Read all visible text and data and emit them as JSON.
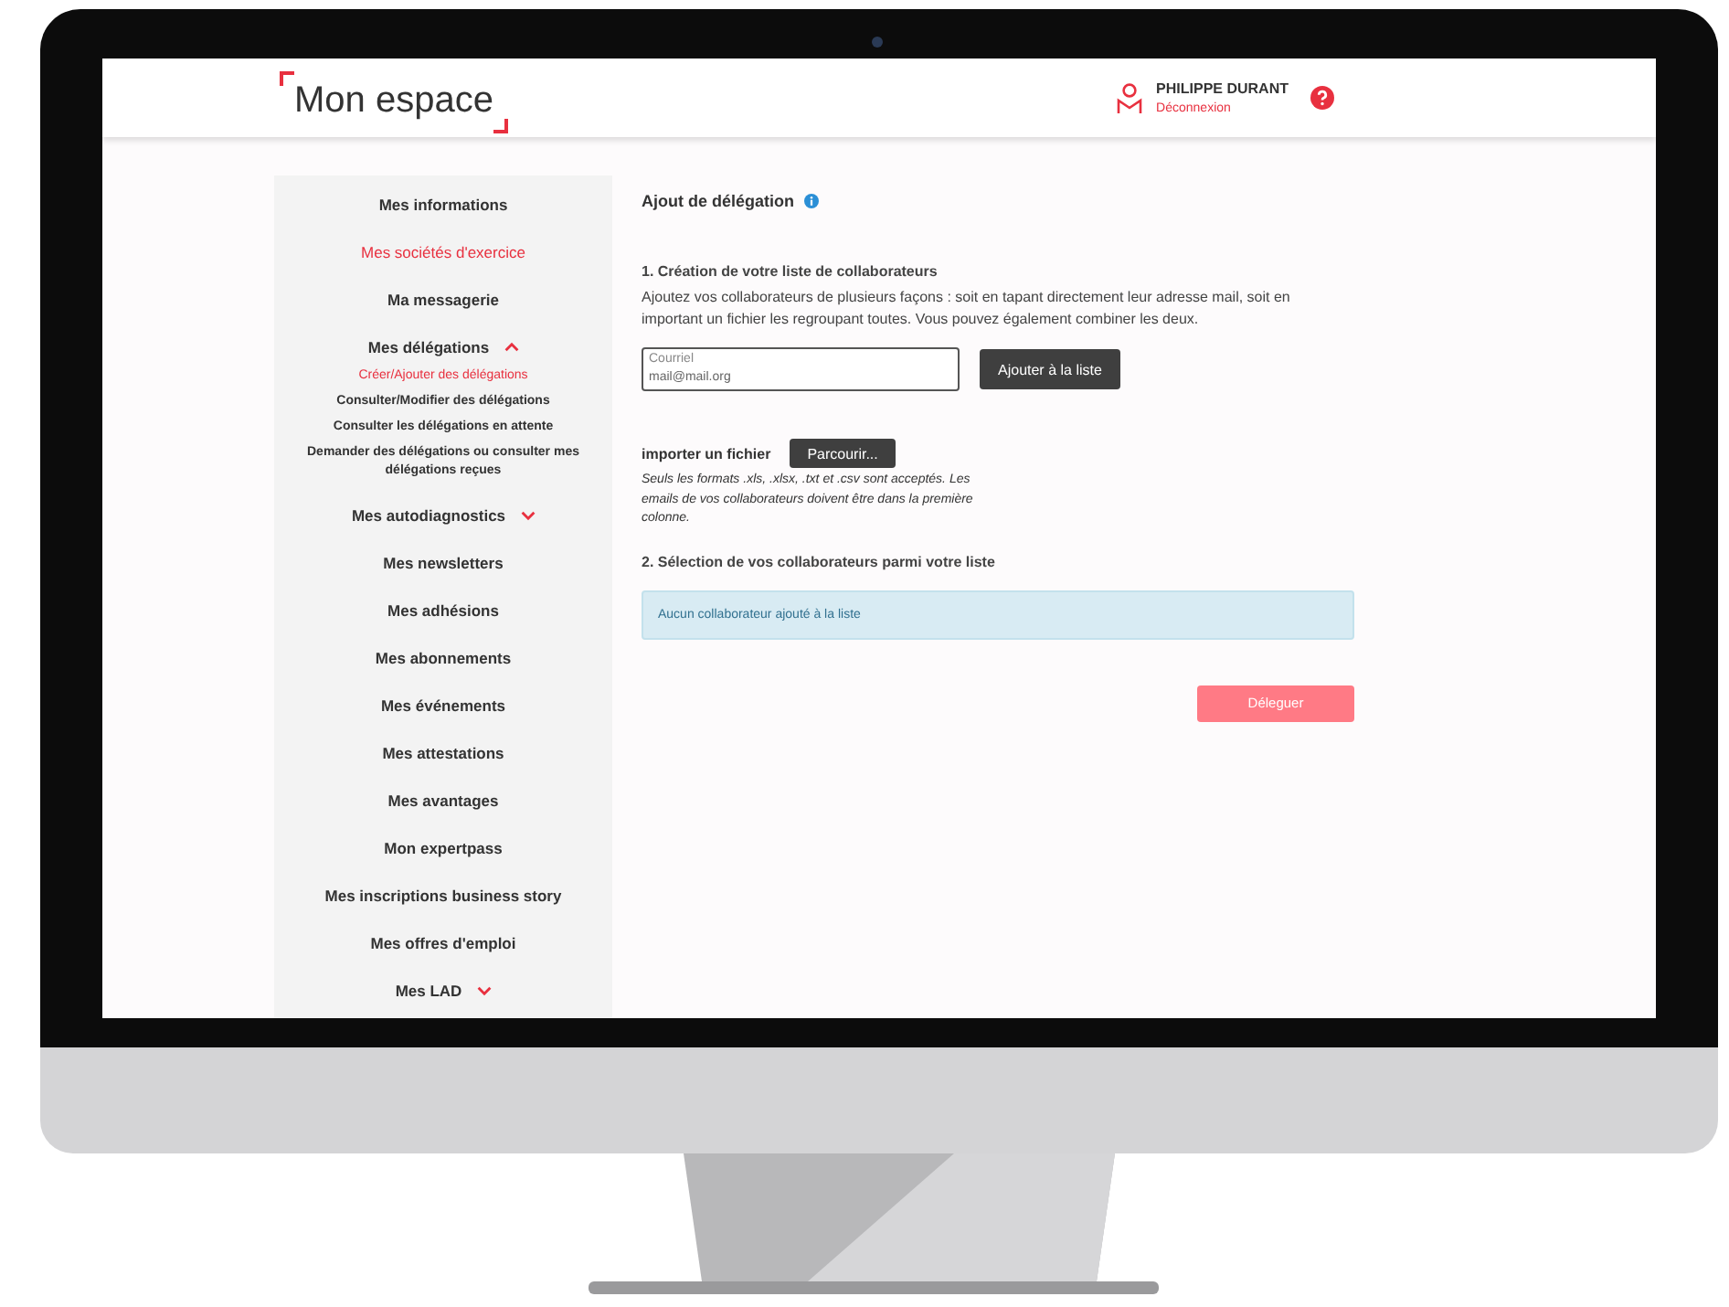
{
  "header": {
    "logo": "Mon espace",
    "user_name": "PHILIPPE DURANT",
    "logout": "Déconnexion"
  },
  "sidebar": {
    "items": [
      {
        "label": "Mes informations",
        "selected": false
      },
      {
        "label": "Mes sociétés d'exercice",
        "selected": true
      },
      {
        "label": "Ma messagerie",
        "selected": false
      },
      {
        "label": "Mes délégations",
        "selected": false,
        "expanded": true,
        "children": [
          {
            "label": "Créer/Ajouter des délégations",
            "selected": true
          },
          {
            "label": "Consulter/Modifier des délégations",
            "selected": false
          },
          {
            "label": "Consulter les délégations en attente",
            "selected": false
          },
          {
            "label": "Demander des délégations ou consulter mes délégations reçues",
            "selected": false
          }
        ]
      },
      {
        "label": "Mes autodiagnostics",
        "selected": false,
        "expanded": false
      },
      {
        "label": "Mes newsletters",
        "selected": false
      },
      {
        "label": "Mes adhésions",
        "selected": false
      },
      {
        "label": "Mes abonnements",
        "selected": false
      },
      {
        "label": "Mes événements",
        "selected": false
      },
      {
        "label": "Mes attestations",
        "selected": false
      },
      {
        "label": "Mes avantages",
        "selected": false
      },
      {
        "label": "Mon expertpass",
        "selected": false
      },
      {
        "label": "Mes inscriptions business story",
        "selected": false
      },
      {
        "label": "Mes offres d'emploi",
        "selected": false
      },
      {
        "label": "Mes LAD",
        "selected": false,
        "expanded": false
      }
    ]
  },
  "main": {
    "title": "Ajout de délégation",
    "section_1": {
      "heading": "1. Création de votre liste de collaborateurs",
      "description": "Ajoutez vos collaborateurs de plusieurs façons : soit en tapant directement leur adresse mail, soit en important un fichier les regroupant toutes. Vous pouvez également combiner les deux.",
      "email_field": {
        "label": "Courriel",
        "placeholder": "mail@mail.org"
      },
      "add_button": "Ajouter à la liste",
      "import_label": "importer un fichier",
      "browse_button": "Parcourir...",
      "import_note": "Seuls les formats .xls, .xlsx, .txt et .csv sont acceptés. Les emails de vos collaborateurs doivent être dans la première colonne."
    },
    "section_2": {
      "heading": "2. Sélection de vos collaborateurs parmi votre liste",
      "empty_message": "Aucun collaborateur ajouté à la liste"
    },
    "delegate_button": {
      "label": "Déleguer",
      "disabled": true
    }
  }
}
